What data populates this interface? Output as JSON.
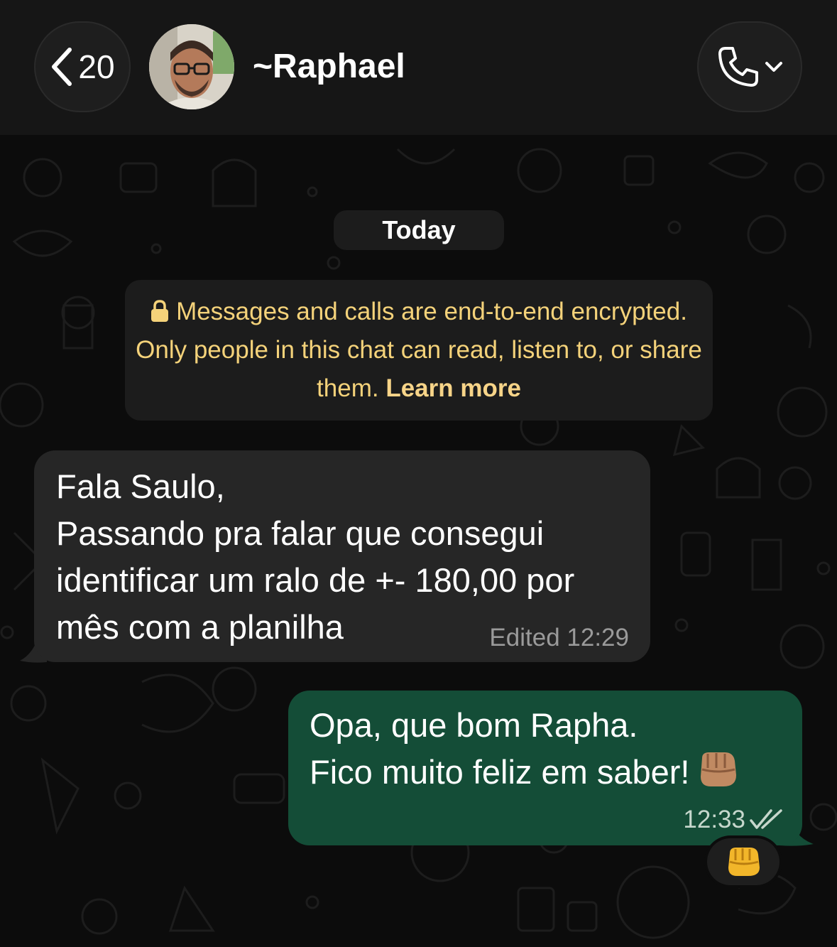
{
  "header": {
    "back_count": "20",
    "contact_name": "~Raphael",
    "avatar_alt": "Raphael avatar"
  },
  "chat": {
    "date_label": "Today",
    "encryption": {
      "text": "Messages and calls are end-to-end encrypted. Only people in this chat can read, listen to, or share them.",
      "link": "Learn more"
    },
    "messages": [
      {
        "direction": "incoming",
        "text": "Fala Saulo,\nPassando pra falar que consegui identificar um ralo de +- 180,00 por mês com a planilha",
        "status": "Edited",
        "time": "12:29"
      },
      {
        "direction": "outgoing",
        "lines": [
          "Opa, que bom Rapha.",
          "Fico muito feliz em saber!"
        ],
        "time": "12:33",
        "read": true,
        "reaction": "fist-bump"
      }
    ]
  },
  "colors": {
    "incoming_bubble": "#262626",
    "outgoing_bubble": "#144d37",
    "system_text": "#f4d27a",
    "background": "#0c0c0c"
  },
  "icons": [
    "chevron-left-icon",
    "phone-icon",
    "chevron-down-icon",
    "lock-icon",
    "double-check-icon",
    "fist-bump-emoji"
  ]
}
